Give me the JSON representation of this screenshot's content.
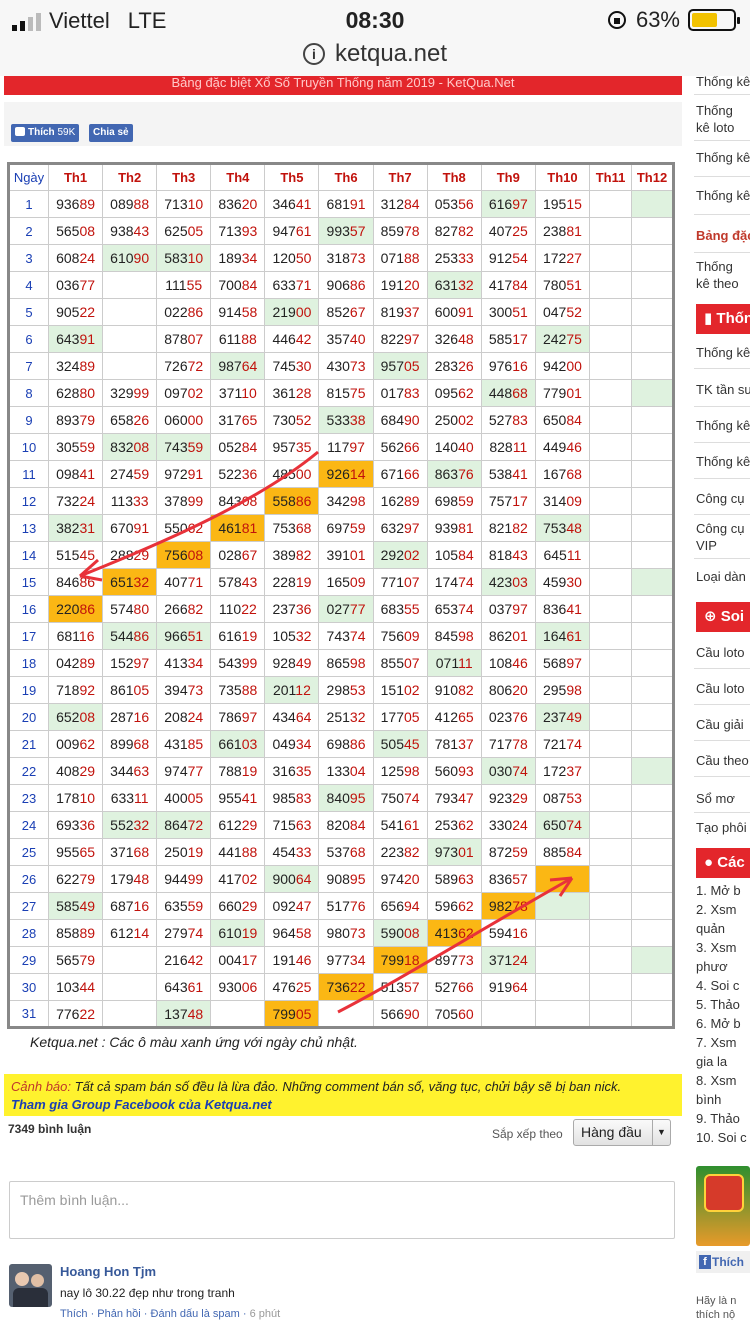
{
  "status_bar": {
    "carrier": "Viettel",
    "network": "LTE",
    "time": "08:30",
    "battery": "63%",
    "battery_level": 0.63
  },
  "browser": {
    "url": "ketqua.net"
  },
  "page": {
    "banner": "Bảng đặc biệt Xổ Số Truyền Thống năm 2019 - KetQua.Net",
    "fb_like_label": "Thích",
    "fb_like_count": "59K",
    "fb_share_label": "Chia sẻ",
    "note": "Ketqua.net : Các ô màu xanh ứng với ngày chủ nhật.",
    "warning_label": "Cảnh báo:",
    "warning_text": "Tất cả spam bán số đều là lừa đảo. Những comment bán số, văng tục, chửi bậy sẽ bị ban nick.",
    "warning_link": "Tham gia Group Facebook của Ketqua.net"
  },
  "table": {
    "headers": [
      "Ngày",
      "Th1",
      "Th2",
      "Th3",
      "Th4",
      "Th5",
      "Th6",
      "Th7",
      "Th8",
      "Th9",
      "Th10",
      "Th11",
      "Th12"
    ],
    "rows": [
      [
        "1",
        "93689",
        "08988",
        "71310",
        "83620",
        "34641",
        "68191",
        "31284",
        "05356",
        "61697",
        "19515",
        "",
        ""
      ],
      [
        "2",
        "56508",
        "93843",
        "62505",
        "71393",
        "94761",
        "99357",
        "85978",
        "82782",
        "40725",
        "23881",
        "",
        ""
      ],
      [
        "3",
        "60824",
        "61090",
        "58310",
        "18934",
        "12050",
        "31873",
        "07188",
        "25333",
        "91254",
        "17227",
        "",
        ""
      ],
      [
        "4",
        "03677",
        "",
        "11155",
        "70084",
        "63371",
        "90686",
        "19120",
        "63132",
        "41784",
        "78051",
        "",
        ""
      ],
      [
        "5",
        "90522",
        "",
        "02286",
        "91458",
        "21900",
        "85267",
        "81937",
        "60091",
        "30051",
        "04752",
        "",
        ""
      ],
      [
        "6",
        "64391",
        "",
        "87807",
        "61188",
        "44642",
        "35740",
        "82297",
        "32648",
        "58517",
        "24275",
        "",
        ""
      ],
      [
        "7",
        "32489",
        "",
        "72672",
        "98764",
        "74530",
        "43073",
        "95705",
        "28326",
        "97616",
        "94200",
        "",
        ""
      ],
      [
        "8",
        "62880",
        "32999",
        "09702",
        "37110",
        "36128",
        "81575",
        "01783",
        "09562",
        "44868",
        "77901",
        "",
        ""
      ],
      [
        "9",
        "89379",
        "65826",
        "06000",
        "31765",
        "73052",
        "53338",
        "68490",
        "25002",
        "52783",
        "65084",
        "",
        ""
      ],
      [
        "10",
        "30559",
        "83208",
        "74359",
        "05284",
        "95735",
        "11797",
        "56266",
        "14040",
        "82811",
        "44946",
        "",
        ""
      ],
      [
        "11",
        "09841",
        "27459",
        "97291",
        "52236",
        "48500",
        "92614",
        "67166",
        "86376",
        "53841",
        "16768",
        "",
        ""
      ],
      [
        "12",
        "73224",
        "11333",
        "37899",
        "84308",
        "55886",
        "34298",
        "16289",
        "69859",
        "75717",
        "31409",
        "",
        ""
      ],
      [
        "13",
        "38231",
        "67091",
        "55062",
        "46181",
        "75368",
        "69759",
        "63297",
        "93981",
        "82182",
        "75348",
        "",
        ""
      ],
      [
        "14",
        "51545",
        "28829",
        "75608",
        "02867",
        "38982",
        "39101",
        "29202",
        "10584",
        "81843",
        "64511",
        "",
        ""
      ],
      [
        "15",
        "84686",
        "65132",
        "40771",
        "57843",
        "22819",
        "16509",
        "77107",
        "17474",
        "42303",
        "45930",
        "",
        ""
      ],
      [
        "16",
        "22086",
        "57480",
        "26682",
        "11022",
        "23736",
        "02777",
        "68355",
        "65374",
        "03797",
        "83641",
        "",
        ""
      ],
      [
        "17",
        "68116",
        "54486",
        "96651",
        "61619",
        "10532",
        "74374",
        "75609",
        "84598",
        "86201",
        "16461",
        "",
        ""
      ],
      [
        "18",
        "04289",
        "15297",
        "41334",
        "54399",
        "92849",
        "86598",
        "85507",
        "07111",
        "10846",
        "56897",
        "",
        ""
      ],
      [
        "19",
        "71892",
        "86105",
        "39473",
        "73588",
        "20112",
        "29853",
        "15102",
        "91082",
        "80620",
        "29598",
        "",
        ""
      ],
      [
        "20",
        "65208",
        "28716",
        "20824",
        "78697",
        "43464",
        "25132",
        "17705",
        "41265",
        "02376",
        "23749",
        "",
        ""
      ],
      [
        "21",
        "00962",
        "89968",
        "43185",
        "66103",
        "04934",
        "69886",
        "50545",
        "78137",
        "71778",
        "72174",
        "",
        ""
      ],
      [
        "22",
        "40829",
        "34463",
        "97477",
        "78819",
        "31635",
        "13304",
        "12598",
        "56093",
        "03074",
        "17237",
        "",
        ""
      ],
      [
        "23",
        "17810",
        "63311",
        "40005",
        "95541",
        "98583",
        "84095",
        "75074",
        "79347",
        "92329",
        "08753",
        "",
        ""
      ],
      [
        "24",
        "69336",
        "55232",
        "86472",
        "61229",
        "71563",
        "82084",
        "54161",
        "25362",
        "33024",
        "65074",
        "",
        ""
      ],
      [
        "25",
        "95565",
        "37168",
        "25019",
        "44188",
        "45433",
        "53768",
        "22382",
        "97301",
        "87259",
        "88584",
        "",
        ""
      ],
      [
        "26",
        "62279",
        "17948",
        "94499",
        "41702",
        "90064",
        "90895",
        "97420",
        "58963",
        "83657",
        "",
        "",
        ""
      ],
      [
        "27",
        "58549",
        "68716",
        "63559",
        "66029",
        "09247",
        "51776",
        "65694",
        "59662",
        "98278",
        "",
        "",
        ""
      ],
      [
        "28",
        "85889",
        "61214",
        "27974",
        "61019",
        "96458",
        "98073",
        "59008",
        "41362",
        "59416",
        "",
        "",
        ""
      ],
      [
        "29",
        "56579",
        "",
        "21642",
        "00417",
        "19146",
        "97734",
        "79918",
        "89773",
        "37124",
        "",
        "",
        ""
      ],
      [
        "30",
        "10344",
        "",
        "64361",
        "93006",
        "47625",
        "73622",
        "51357",
        "52766",
        "91964",
        "",
        "",
        ""
      ],
      [
        "31",
        "77622",
        "",
        "13748",
        "",
        "79905",
        "",
        "56690",
        "70560",
        "",
        "",
        "",
        ""
      ]
    ],
    "green_cells": [
      "1-9",
      "1-12",
      "2-6",
      "3-2",
      "3-3",
      "4-8",
      "5-5",
      "6-1",
      "6-10",
      "7-4",
      "7-7",
      "8-9",
      "8-12",
      "9-6",
      "10-2",
      "10-3",
      "11-8",
      "13-1",
      "13-10",
      "14-7",
      "15-9",
      "15-12",
      "16-6",
      "17-2",
      "17-3",
      "17-10",
      "18-8",
      "19-5",
      "20-1",
      "20-10",
      "21-4",
      "21-7",
      "22-9",
      "22-12",
      "23-6",
      "24-2",
      "24-3",
      "24-10",
      "25-8",
      "26-5",
      "27-1",
      "27-10",
      "28-4",
      "28-7",
      "29-9",
      "29-12",
      "30-6",
      "31-3"
    ],
    "orange_cells": [
      "11-6",
      "12-5",
      "13-4",
      "14-3",
      "15-2",
      "16-1",
      "26-10",
      "27-9",
      "28-8",
      "29-7",
      "30-6",
      "31-5"
    ]
  },
  "comments": {
    "count": "7349 bình luận",
    "sort_label": "Sắp xếp theo",
    "sort_value": "Hàng đầu",
    "input_placeholder": "Thêm bình luận...",
    "items": [
      {
        "name": "Hoang Hon Tjm",
        "text": "nay lô 30.22 đẹp như trong tranh",
        "like": "Thích",
        "reply": "Phản hồi",
        "spam": "Đánh dấu là spam",
        "time": "6 phút"
      }
    ]
  },
  "sidebar": {
    "items_top": [
      "Thống kê",
      "Thống kê loto",
      "Thống kê",
      "Thống kê",
      "Bảng đặc",
      "Thống kê theo Đặc"
    ],
    "head1": "Thống",
    "items_mid": [
      "Thống kê",
      "TK tần suất",
      "Thống kê",
      "Thống kê",
      "Công cụ",
      "Công cụ VIP",
      "Loại dàn"
    ],
    "head2": "Soi",
    "items_soi": [
      "Cầu loto",
      "Cầu loto",
      "Cầu giải",
      "Cầu theo",
      "Sổ mơ",
      "Tạo phôi"
    ],
    "head3": "Các",
    "list": [
      "1.  Mở b",
      "2.  Xsm",
      "    quản",
      "3.  Xsm",
      "    phươ",
      "4.  Soi c",
      "5.  Thảo",
      "6.  Mở b",
      "7.  Xsm",
      "    gia la",
      "8.  Xsm",
      "    bình",
      "9.  Thảo",
      "10. Soi c"
    ],
    "fb_like": "Thích",
    "footer": "Hãy là n thích nộ"
  },
  "colors": {
    "accent_red": "#e3262b",
    "orange": "#fbb714",
    "green": "#dff2df",
    "link_blue": "#1a3fb4"
  }
}
